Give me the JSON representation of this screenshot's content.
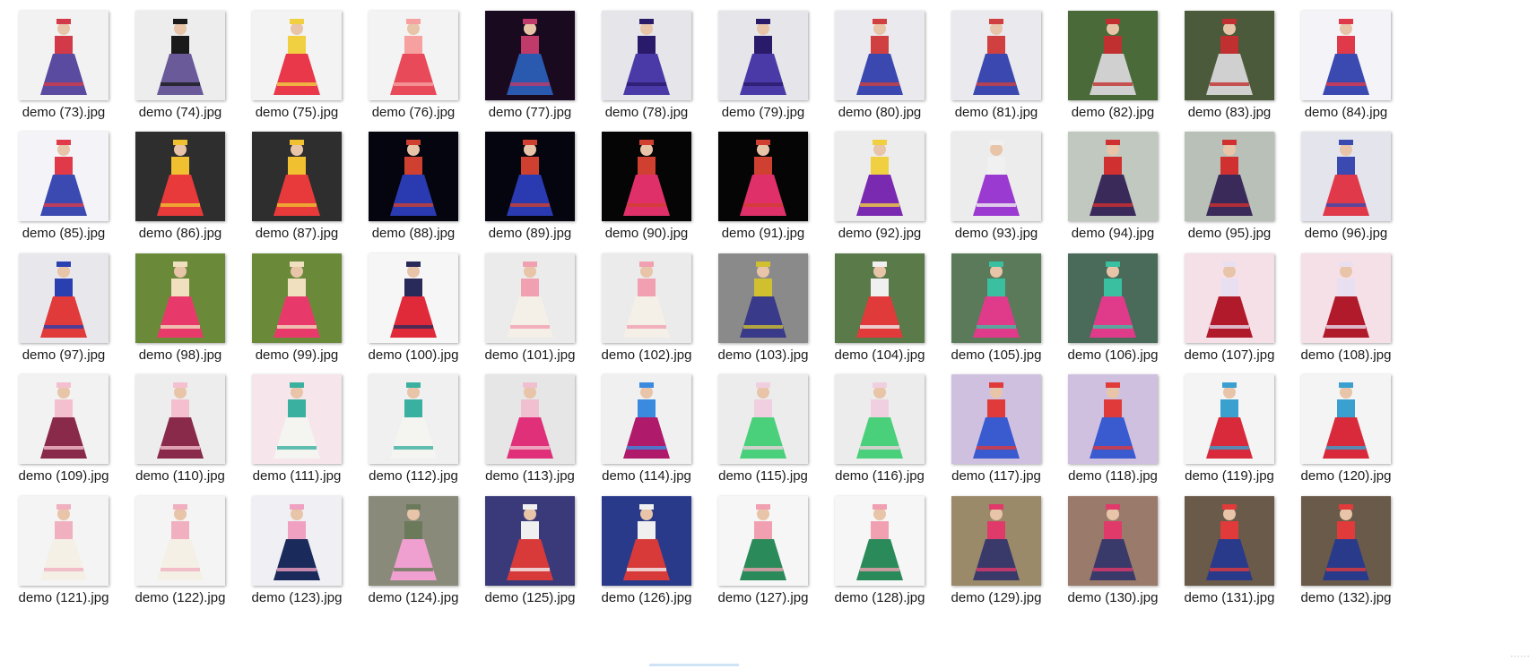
{
  "explorer": {
    "files": [
      {
        "name": "demo (73).jpg",
        "bg": "#f2f2f2",
        "fg": "#5a4aa0",
        "acc": "#d23a4a"
      },
      {
        "name": "demo (74).jpg",
        "bg": "#ededed",
        "fg": "#6a5a9a",
        "acc": "#1a1a1a"
      },
      {
        "name": "demo (75).jpg",
        "bg": "#f3f3f3",
        "fg": "#e8384a",
        "acc": "#f0d040"
      },
      {
        "name": "demo (76).jpg",
        "bg": "#f3f3f3",
        "fg": "#e84a5a",
        "acc": "#f6a0a0"
      },
      {
        "name": "demo (77).jpg",
        "bg": "#1a0a20",
        "fg": "#2a5ab0",
        "acc": "#c03a6a"
      },
      {
        "name": "demo (78).jpg",
        "bg": "#e6e6ea",
        "fg": "#4a3aa8",
        "acc": "#2a1a6a"
      },
      {
        "name": "demo (79).jpg",
        "bg": "#e6e6ea",
        "fg": "#4a3aa8",
        "acc": "#2a1a6a"
      },
      {
        "name": "demo (80).jpg",
        "bg": "#e9e9ee",
        "fg": "#3a48b0",
        "acc": "#d04040"
      },
      {
        "name": "demo (81).jpg",
        "bg": "#e9e9ee",
        "fg": "#3a48b0",
        "acc": "#d04040"
      },
      {
        "name": "demo (82).jpg",
        "bg": "#4a6a3a",
        "fg": "#d0d0d0",
        "acc": "#c03030"
      },
      {
        "name": "demo (83).jpg",
        "bg": "#4a5a3a",
        "fg": "#d0d0d0",
        "acc": "#c03030"
      },
      {
        "name": "demo (84).jpg",
        "bg": "#f4f4f8",
        "fg": "#3a4ab0",
        "acc": "#e03a4a"
      },
      {
        "name": "demo (85).jpg",
        "bg": "#f4f4f8",
        "fg": "#3a4ab0",
        "acc": "#e03a4a"
      },
      {
        "name": "demo (86).jpg",
        "bg": "#2e2e2e",
        "fg": "#e83a3a",
        "acc": "#f0c030"
      },
      {
        "name": "demo (87).jpg",
        "bg": "#2e2e2e",
        "fg": "#e83a3a",
        "acc": "#f0c030"
      },
      {
        "name": "demo (88).jpg",
        "bg": "#050510",
        "fg": "#2a3ab0",
        "acc": "#d04030"
      },
      {
        "name": "demo (89).jpg",
        "bg": "#050510",
        "fg": "#2a3ab0",
        "acc": "#d04030"
      },
      {
        "name": "demo (90).jpg",
        "bg": "#050505",
        "fg": "#e0306a",
        "acc": "#d04030"
      },
      {
        "name": "demo (91).jpg",
        "bg": "#050505",
        "fg": "#e0306a",
        "acc": "#d04030"
      },
      {
        "name": "demo (92).jpg",
        "bg": "#ececec",
        "fg": "#7a2ab0",
        "acc": "#f0d040"
      },
      {
        "name": "demo (93).jpg",
        "bg": "#ececec",
        "fg": "#9a3ad0",
        "acc": "#f0f0f0"
      },
      {
        "name": "demo (94).jpg",
        "bg": "#c0c8c0",
        "fg": "#3a2a5a",
        "acc": "#d03030"
      },
      {
        "name": "demo (95).jpg",
        "bg": "#b8c0b8",
        "fg": "#3a2a5a",
        "acc": "#d03030"
      },
      {
        "name": "demo (96).jpg",
        "bg": "#e4e4ec",
        "fg": "#e03a4a",
        "acc": "#3a4ab0"
      },
      {
        "name": "demo (97).jpg",
        "bg": "#e8e8ec",
        "fg": "#e03a3a",
        "acc": "#2a40b0"
      },
      {
        "name": "demo (98).jpg",
        "bg": "#6a8a3a",
        "fg": "#e83a6a",
        "acc": "#f0e0c0"
      },
      {
        "name": "demo (99).jpg",
        "bg": "#6a8a3a",
        "fg": "#e83a6a",
        "acc": "#f0e0c0"
      },
      {
        "name": "demo (100).jpg",
        "bg": "#f6f6f6",
        "fg": "#e02a3a",
        "acc": "#2a2a5a"
      },
      {
        "name": "demo (101).jpg",
        "bg": "#ebebeb",
        "fg": "#f4f0e8",
        "acc": "#f0a0b0"
      },
      {
        "name": "demo (102).jpg",
        "bg": "#ebebeb",
        "fg": "#f4f0e8",
        "acc": "#f0a0b0"
      },
      {
        "name": "demo (103).jpg",
        "bg": "#8a8a8a",
        "fg": "#3a3a8a",
        "acc": "#d0c030"
      },
      {
        "name": "demo (104).jpg",
        "bg": "#5a7a4a",
        "fg": "#e03a3a",
        "acc": "#f0f0f0"
      },
      {
        "name": "demo (105).jpg",
        "bg": "#5a7a5a",
        "fg": "#e03a8a",
        "acc": "#3ac0a0"
      },
      {
        "name": "demo (106).jpg",
        "bg": "#4a6a5a",
        "fg": "#e03a8a",
        "acc": "#3ac0a0"
      },
      {
        "name": "demo (107).jpg",
        "bg": "#f6e0e8",
        "fg": "#b01a2a",
        "acc": "#e8e0f0"
      },
      {
        "name": "demo (108).jpg",
        "bg": "#f6e0e8",
        "fg": "#b01a2a",
        "acc": "#e8e0f0"
      },
      {
        "name": "demo (109).jpg",
        "bg": "#f2f2f2",
        "fg": "#8a2a4a",
        "acc": "#f4c0d0"
      },
      {
        "name": "demo (110).jpg",
        "bg": "#ededed",
        "fg": "#8a2a4a",
        "acc": "#f4c0d0"
      },
      {
        "name": "demo (111).jpg",
        "bg": "#f6e6ec",
        "fg": "#f4f4f0",
        "acc": "#3ab0a0"
      },
      {
        "name": "demo (112).jpg",
        "bg": "#f0f0f0",
        "fg": "#f4f4f0",
        "acc": "#3ab0a0"
      },
      {
        "name": "demo (113).jpg",
        "bg": "#e6e6e6",
        "fg": "#e0307a",
        "acc": "#f0c0d0"
      },
      {
        "name": "demo (114).jpg",
        "bg": "#f0f0f0",
        "fg": "#b01a6a",
        "acc": "#3a8ae0"
      },
      {
        "name": "demo (115).jpg",
        "bg": "#ececec",
        "fg": "#4ad07a",
        "acc": "#f0d0e0"
      },
      {
        "name": "demo (116).jpg",
        "bg": "#ececec",
        "fg": "#4ad07a",
        "acc": "#f0d0e0"
      },
      {
        "name": "demo (117).jpg",
        "bg": "#d0c0e0",
        "fg": "#3a5ad0",
        "acc": "#e03a3a"
      },
      {
        "name": "demo (118).jpg",
        "bg": "#d0c0e0",
        "fg": "#3a5ad0",
        "acc": "#e03a3a"
      },
      {
        "name": "demo (119).jpg",
        "bg": "#f4f4f4",
        "fg": "#d82a3a",
        "acc": "#3aa0d0"
      },
      {
        "name": "demo (120).jpg",
        "bg": "#f4f4f4",
        "fg": "#d82a3a",
        "acc": "#3aa0d0"
      },
      {
        "name": "demo (121).jpg",
        "bg": "#f4f4f4",
        "fg": "#f4f0e6",
        "acc": "#f0b0c0"
      },
      {
        "name": "demo (122).jpg",
        "bg": "#f4f4f4",
        "fg": "#f4f0e6",
        "acc": "#f0b0c0"
      },
      {
        "name": "demo (123).jpg",
        "bg": "#f0f0f4",
        "fg": "#1a2a5a",
        "acc": "#f0a0c0"
      },
      {
        "name": "demo (124).jpg",
        "bg": "#8a8a7a",
        "fg": "#f0a0d0",
        "acc": "#6a7a5a"
      },
      {
        "name": "demo (125).jpg",
        "bg": "#3a3a7a",
        "fg": "#d83a3a",
        "acc": "#f0f0f0"
      },
      {
        "name": "demo (126).jpg",
        "bg": "#2a3a8a",
        "fg": "#d83a3a",
        "acc": "#f0f0f0"
      },
      {
        "name": "demo (127).jpg",
        "bg": "#f6f6f6",
        "fg": "#2a8a5a",
        "acc": "#f0a0b0"
      },
      {
        "name": "demo (128).jpg",
        "bg": "#f6f6f6",
        "fg": "#2a8a5a",
        "acc": "#f0a0b0"
      },
      {
        "name": "demo (129).jpg",
        "bg": "#9a8a6a",
        "fg": "#3a3a6a",
        "acc": "#e03a6a"
      },
      {
        "name": "demo (130).jpg",
        "bg": "#9a7a6a",
        "fg": "#3a3a6a",
        "acc": "#e03a6a"
      },
      {
        "name": "demo (131).jpg",
        "bg": "#6a5a4a",
        "fg": "#2a3a8a",
        "acc": "#e03a3a"
      },
      {
        "name": "demo (132).jpg",
        "bg": "#6a5a4a",
        "fg": "#2a3a8a",
        "acc": "#e03a3a"
      }
    ],
    "watermark": "······"
  }
}
